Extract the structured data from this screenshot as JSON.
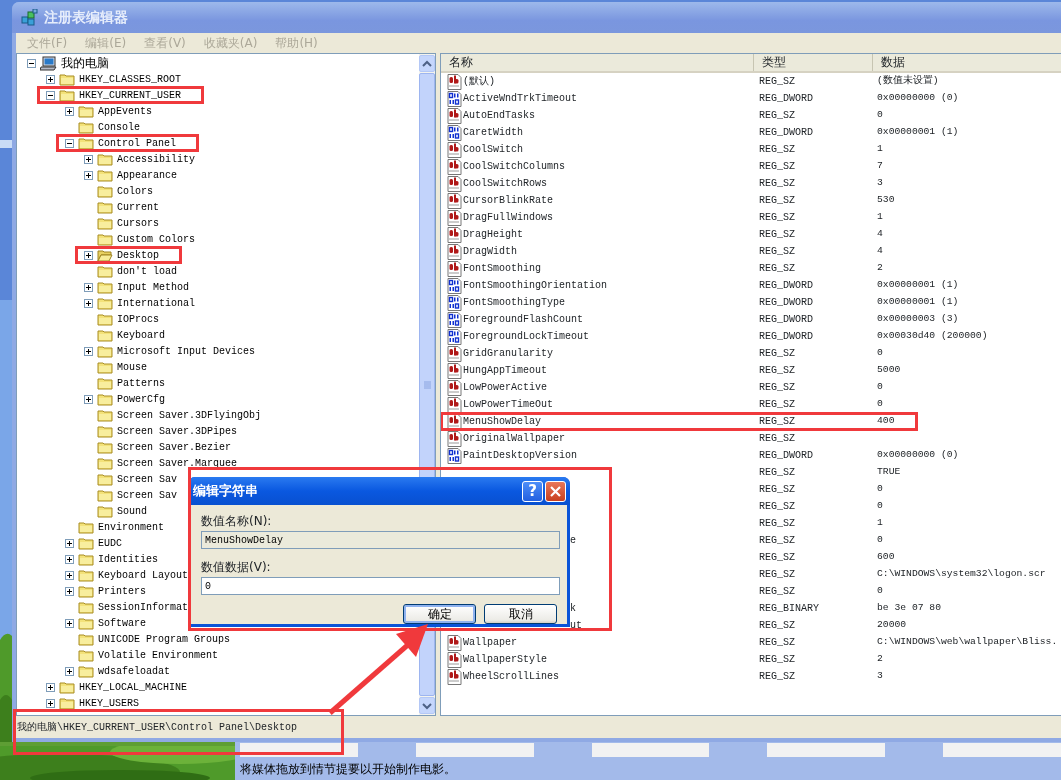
{
  "window": {
    "title": "注册表编辑器",
    "active": false
  },
  "menu": [
    {
      "label": "文件(F)",
      "disabled": true
    },
    {
      "label": "编辑(E)",
      "disabled": true
    },
    {
      "label": "查看(V)",
      "disabled": true
    },
    {
      "label": "收藏夹(A)",
      "disabled": true
    },
    {
      "label": "帮助(H)",
      "disabled": true
    }
  ],
  "tree": {
    "nodes": [
      {
        "label": "我的电脑",
        "kind": "computer",
        "expanded": true,
        "selected": false,
        "annotated": false,
        "children": [
          {
            "label": "HKEY_CLASSES_ROOT",
            "kind": "folder",
            "expanded": false,
            "selected": false,
            "annotated": false
          },
          {
            "label": "HKEY_CURRENT_USER",
            "kind": "folder",
            "expanded": true,
            "selected": false,
            "annotated": true,
            "children": [
              {
                "label": "AppEvents",
                "kind": "folder",
                "expanded": false,
                "selected": false,
                "annotated": false
              },
              {
                "label": "Console",
                "kind": "folder",
                "selected": false,
                "annotated": false
              },
              {
                "label": "Control Panel",
                "kind": "folder",
                "expanded": true,
                "selected": false,
                "annotated": true,
                "children": [
                  {
                    "label": "Accessibility",
                    "kind": "folder",
                    "expanded": false,
                    "selected": false,
                    "annotated": false
                  },
                  {
                    "label": "Appearance",
                    "kind": "folder",
                    "expanded": false,
                    "selected": false,
                    "annotated": false
                  },
                  {
                    "label": "Colors",
                    "kind": "folder",
                    "selected": false,
                    "annotated": false
                  },
                  {
                    "label": "Current",
                    "kind": "folder",
                    "selected": false,
                    "annotated": false
                  },
                  {
                    "label": "Cursors",
                    "kind": "folder",
                    "selected": false,
                    "annotated": false
                  },
                  {
                    "label": "Custom Colors",
                    "kind": "folder",
                    "selected": false,
                    "annotated": false
                  },
                  {
                    "label": "Desktop",
                    "kind": "folder",
                    "expanded": false,
                    "selected": true,
                    "annotated": true
                  },
                  {
                    "label": "don't load",
                    "kind": "folder",
                    "selected": false,
                    "annotated": false
                  },
                  {
                    "label": "Input Method",
                    "kind": "folder",
                    "expanded": false,
                    "selected": false,
                    "annotated": false
                  },
                  {
                    "label": "International",
                    "kind": "folder",
                    "expanded": false,
                    "selected": false,
                    "annotated": false
                  },
                  {
                    "label": "IOProcs",
                    "kind": "folder",
                    "selected": false,
                    "annotated": false
                  },
                  {
                    "label": "Keyboard",
                    "kind": "folder",
                    "selected": false,
                    "annotated": false
                  },
                  {
                    "label": "Microsoft Input Devices",
                    "kind": "folder",
                    "expanded": false,
                    "selected": false,
                    "annotated": false
                  },
                  {
                    "label": "Mouse",
                    "kind": "folder",
                    "selected": false,
                    "annotated": false
                  },
                  {
                    "label": "Patterns",
                    "kind": "folder",
                    "selected": false,
                    "annotated": false
                  },
                  {
                    "label": "PowerCfg",
                    "kind": "folder",
                    "expanded": false,
                    "selected": false,
                    "annotated": false
                  },
                  {
                    "label": "Screen Saver.3DFlyingObj",
                    "kind": "folder",
                    "selected": false,
                    "annotated": false
                  },
                  {
                    "label": "Screen Saver.3DPipes",
                    "kind": "folder",
                    "selected": false,
                    "annotated": false
                  },
                  {
                    "label": "Screen Saver.Bezier",
                    "kind": "folder",
                    "selected": false,
                    "annotated": false
                  },
                  {
                    "label": "Screen Saver.Marquee",
                    "kind": "folder",
                    "selected": false,
                    "annotated": false
                  },
                  {
                    "label": "Screen Sav",
                    "kind": "folder",
                    "selected": false,
                    "annotated": false
                  },
                  {
                    "label": "Screen Sav",
                    "kind": "folder",
                    "selected": false,
                    "annotated": false
                  },
                  {
                    "label": "Sound",
                    "kind": "folder",
                    "selected": false,
                    "annotated": false
                  }
                ]
              },
              {
                "label": "Environment",
                "kind": "folder",
                "selected": false,
                "annotated": false
              },
              {
                "label": "EUDC",
                "kind": "folder",
                "expanded": false,
                "selected": false,
                "annotated": false
              },
              {
                "label": "Identities",
                "kind": "folder",
                "expanded": false,
                "selected": false,
                "annotated": false
              },
              {
                "label": "Keyboard Layout",
                "kind": "folder",
                "expanded": false,
                "selected": false,
                "annotated": false
              },
              {
                "label": "Printers",
                "kind": "folder",
                "expanded": false,
                "selected": false,
                "annotated": false
              },
              {
                "label": "SessionInformat",
                "kind": "folder",
                "selected": false,
                "annotated": false
              },
              {
                "label": "Software",
                "kind": "folder",
                "expanded": false,
                "selected": false,
                "annotated": false
              },
              {
                "label": "UNICODE Program Groups",
                "kind": "folder",
                "selected": false,
                "annotated": false
              },
              {
                "label": "Volatile Environment",
                "kind": "folder",
                "selected": false,
                "annotated": false
              },
              {
                "label": "wdsafeloadat",
                "kind": "folder",
                "expanded": false,
                "selected": false,
                "annotated": false
              }
            ]
          },
          {
            "label": "HKEY_LOCAL_MACHINE",
            "kind": "folder",
            "expanded": false,
            "selected": false,
            "annotated": false
          },
          {
            "label": "HKEY_USERS",
            "kind": "folder",
            "expanded": false,
            "selected": false,
            "annotated": false
          }
        ]
      }
    ]
  },
  "values": {
    "columns": [
      "名称",
      "类型",
      "数据"
    ],
    "rows": [
      {
        "kind": "sz",
        "name": "(默认)",
        "type": "REG_SZ",
        "data": "(数值未设置)",
        "annotated": false
      },
      {
        "kind": "dword",
        "name": "ActiveWndTrkTimeout",
        "type": "REG_DWORD",
        "data": "0x00000000 (0)",
        "annotated": false
      },
      {
        "kind": "sz",
        "name": "AutoEndTasks",
        "type": "REG_SZ",
        "data": "0",
        "annotated": false
      },
      {
        "kind": "dword",
        "name": "CaretWidth",
        "type": "REG_DWORD",
        "data": "0x00000001 (1)",
        "annotated": false
      },
      {
        "kind": "sz",
        "name": "CoolSwitch",
        "type": "REG_SZ",
        "data": "1",
        "annotated": false
      },
      {
        "kind": "sz",
        "name": "CoolSwitchColumns",
        "type": "REG_SZ",
        "data": "7",
        "annotated": false
      },
      {
        "kind": "sz",
        "name": "CoolSwitchRows",
        "type": "REG_SZ",
        "data": "3",
        "annotated": false
      },
      {
        "kind": "sz",
        "name": "CursorBlinkRate",
        "type": "REG_SZ",
        "data": "530",
        "annotated": false
      },
      {
        "kind": "sz",
        "name": "DragFullWindows",
        "type": "REG_SZ",
        "data": "1",
        "annotated": false
      },
      {
        "kind": "sz",
        "name": "DragHeight",
        "type": "REG_SZ",
        "data": "4",
        "annotated": false
      },
      {
        "kind": "sz",
        "name": "DragWidth",
        "type": "REG_SZ",
        "data": "4",
        "annotated": false
      },
      {
        "kind": "sz",
        "name": "FontSmoothing",
        "type": "REG_SZ",
        "data": "2",
        "annotated": false
      },
      {
        "kind": "dword",
        "name": "FontSmoothingOrientation",
        "type": "REG_DWORD",
        "data": "0x00000001 (1)",
        "annotated": false
      },
      {
        "kind": "dword",
        "name": "FontSmoothingType",
        "type": "REG_DWORD",
        "data": "0x00000001 (1)",
        "annotated": false
      },
      {
        "kind": "dword",
        "name": "ForegroundFlashCount",
        "type": "REG_DWORD",
        "data": "0x00000003 (3)",
        "annotated": false
      },
      {
        "kind": "dword",
        "name": "ForegroundLockTimeout",
        "type": "REG_DWORD",
        "data": "0x00030d40 (200000)",
        "annotated": false
      },
      {
        "kind": "sz",
        "name": "GridGranularity",
        "type": "REG_SZ",
        "data": "0",
        "annotated": false
      },
      {
        "kind": "sz",
        "name": "HungAppTimeout",
        "type": "REG_SZ",
        "data": "5000",
        "annotated": false
      },
      {
        "kind": "sz",
        "name": "LowPowerActive",
        "type": "REG_SZ",
        "data": "0",
        "annotated": false
      },
      {
        "kind": "sz",
        "name": "LowPowerTimeOut",
        "type": "REG_SZ",
        "data": "0",
        "annotated": false
      },
      {
        "kind": "sz",
        "name": "MenuShowDelay",
        "type": "REG_SZ",
        "data": "400",
        "annotated": true
      },
      {
        "kind": "sz",
        "name": "OriginalWallpaper",
        "type": "REG_SZ",
        "annotated": false
      },
      {
        "kind": "dword",
        "name": "PaintDesktopVersion",
        "type": "REG_DWORD",
        "data": "0x00000000 (0)",
        "annotated": false
      },
      {
        "type": "REG_SZ",
        "data": "TRUE",
        "annotated": false
      },
      {
        "type": "REG_SZ",
        "data": "0",
        "annotated": false
      },
      {
        "type": "REG_SZ",
        "data": "0",
        "annotated": false
      },
      {
        "type": "REG_SZ",
        "data": "1",
        "annotated": false
      },
      {
        "name": "e",
        "type": "REG_SZ",
        "data": "0",
        "annotated": false
      },
      {
        "type": "REG_SZ",
        "data": "600",
        "annotated": false
      },
      {
        "type": "REG_SZ",
        "data": "C:\\WINDOWS\\system32\\logon.scr",
        "annotated": false
      },
      {
        "type": "REG_SZ",
        "data": "0",
        "annotated": false
      },
      {
        "name": "k",
        "type": "REG_BINARY",
        "data": "be 3e 07 80",
        "annotated": false
      },
      {
        "name": "ut",
        "type": "REG_SZ",
        "data": "20000",
        "annotated": false
      },
      {
        "kind": "sz",
        "name": "Wallpaper",
        "type": "REG_SZ",
        "data": "C:\\WINDOWS\\web\\wallpaper\\Bliss.",
        "annotated": false
      },
      {
        "kind": "sz",
        "name": "WallpaperStyle",
        "type": "REG_SZ",
        "data": "2",
        "annotated": false
      },
      {
        "kind": "sz",
        "name": "WheelScrollLines",
        "type": "REG_SZ",
        "data": "3",
        "annotated": false
      }
    ]
  },
  "status_bar": {
    "text": "我的电脑\\HKEY_CURRENT_USER\\Control Panel\\Desktop",
    "annotated": true
  },
  "dialog": {
    "title": "编辑字符串",
    "help": "?",
    "annotated": true,
    "fields": [
      {
        "label": "数值名称(N):",
        "value": "MenuShowDelay",
        "disabled": true
      },
      {
        "label": "数值数据(V):",
        "value": "0",
        "disabled": false
      }
    ],
    "buttons": [
      {
        "label": "确定",
        "default": true,
        "pointed": true
      },
      {
        "label": "取消",
        "default": false,
        "pointed": false
      }
    ]
  },
  "storyboard": {
    "hint": "将媒体拖放到情节提要以开始制作电影。"
  }
}
